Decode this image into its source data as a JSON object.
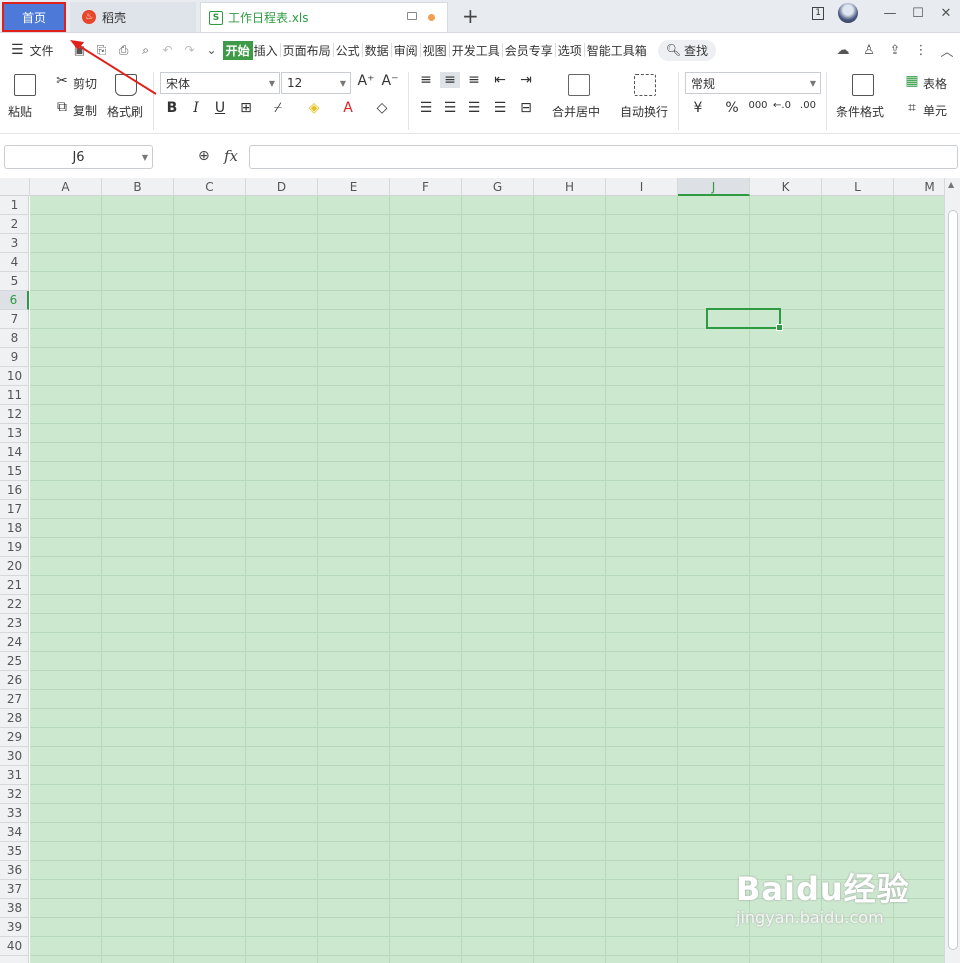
{
  "tabs": {
    "home": "首页",
    "daoke": "稻壳",
    "file": "工作日程表.xls",
    "add": "+"
  },
  "window": {
    "badge": "1",
    "minimize": "—",
    "maximize": "☐",
    "close": "✕"
  },
  "menu": {
    "file": "文件",
    "items": [
      "开始",
      "插入",
      "页面布局",
      "公式",
      "数据",
      "审阅",
      "视图",
      "开发工具",
      "会员专享",
      "选项",
      "智能工具箱"
    ],
    "search": "查找"
  },
  "ribbon": {
    "paste": "粘贴",
    "cut": "剪切",
    "copy": "复制",
    "format_painter": "格式刷",
    "font": "宋体",
    "font_size": "12",
    "merge_center": "合并居中",
    "wrap_text": "自动换行",
    "number_format": "常规",
    "conditional_format": "条件格式",
    "table_style": "表格",
    "cell": "单元",
    "currency": "¥",
    "percent": "%",
    "thousands": "000"
  },
  "formula": {
    "cell_ref": "J6",
    "fx": "fx",
    "value": ""
  },
  "sheet": {
    "columns": [
      "A",
      "B",
      "C",
      "D",
      "E",
      "F",
      "G",
      "H",
      "I",
      "J",
      "K",
      "L",
      "M"
    ],
    "selected_column": "J",
    "selected_row": 6,
    "row_count": 40
  },
  "watermark": {
    "brand": "Baidu经验",
    "url": "jingyan.baidu.com"
  },
  "colors": {
    "accent_green": "#2e9a42",
    "cell_bg": "#cce8cf",
    "home_tab": "#4d7ad8",
    "annotation_red": "#e0201a"
  }
}
